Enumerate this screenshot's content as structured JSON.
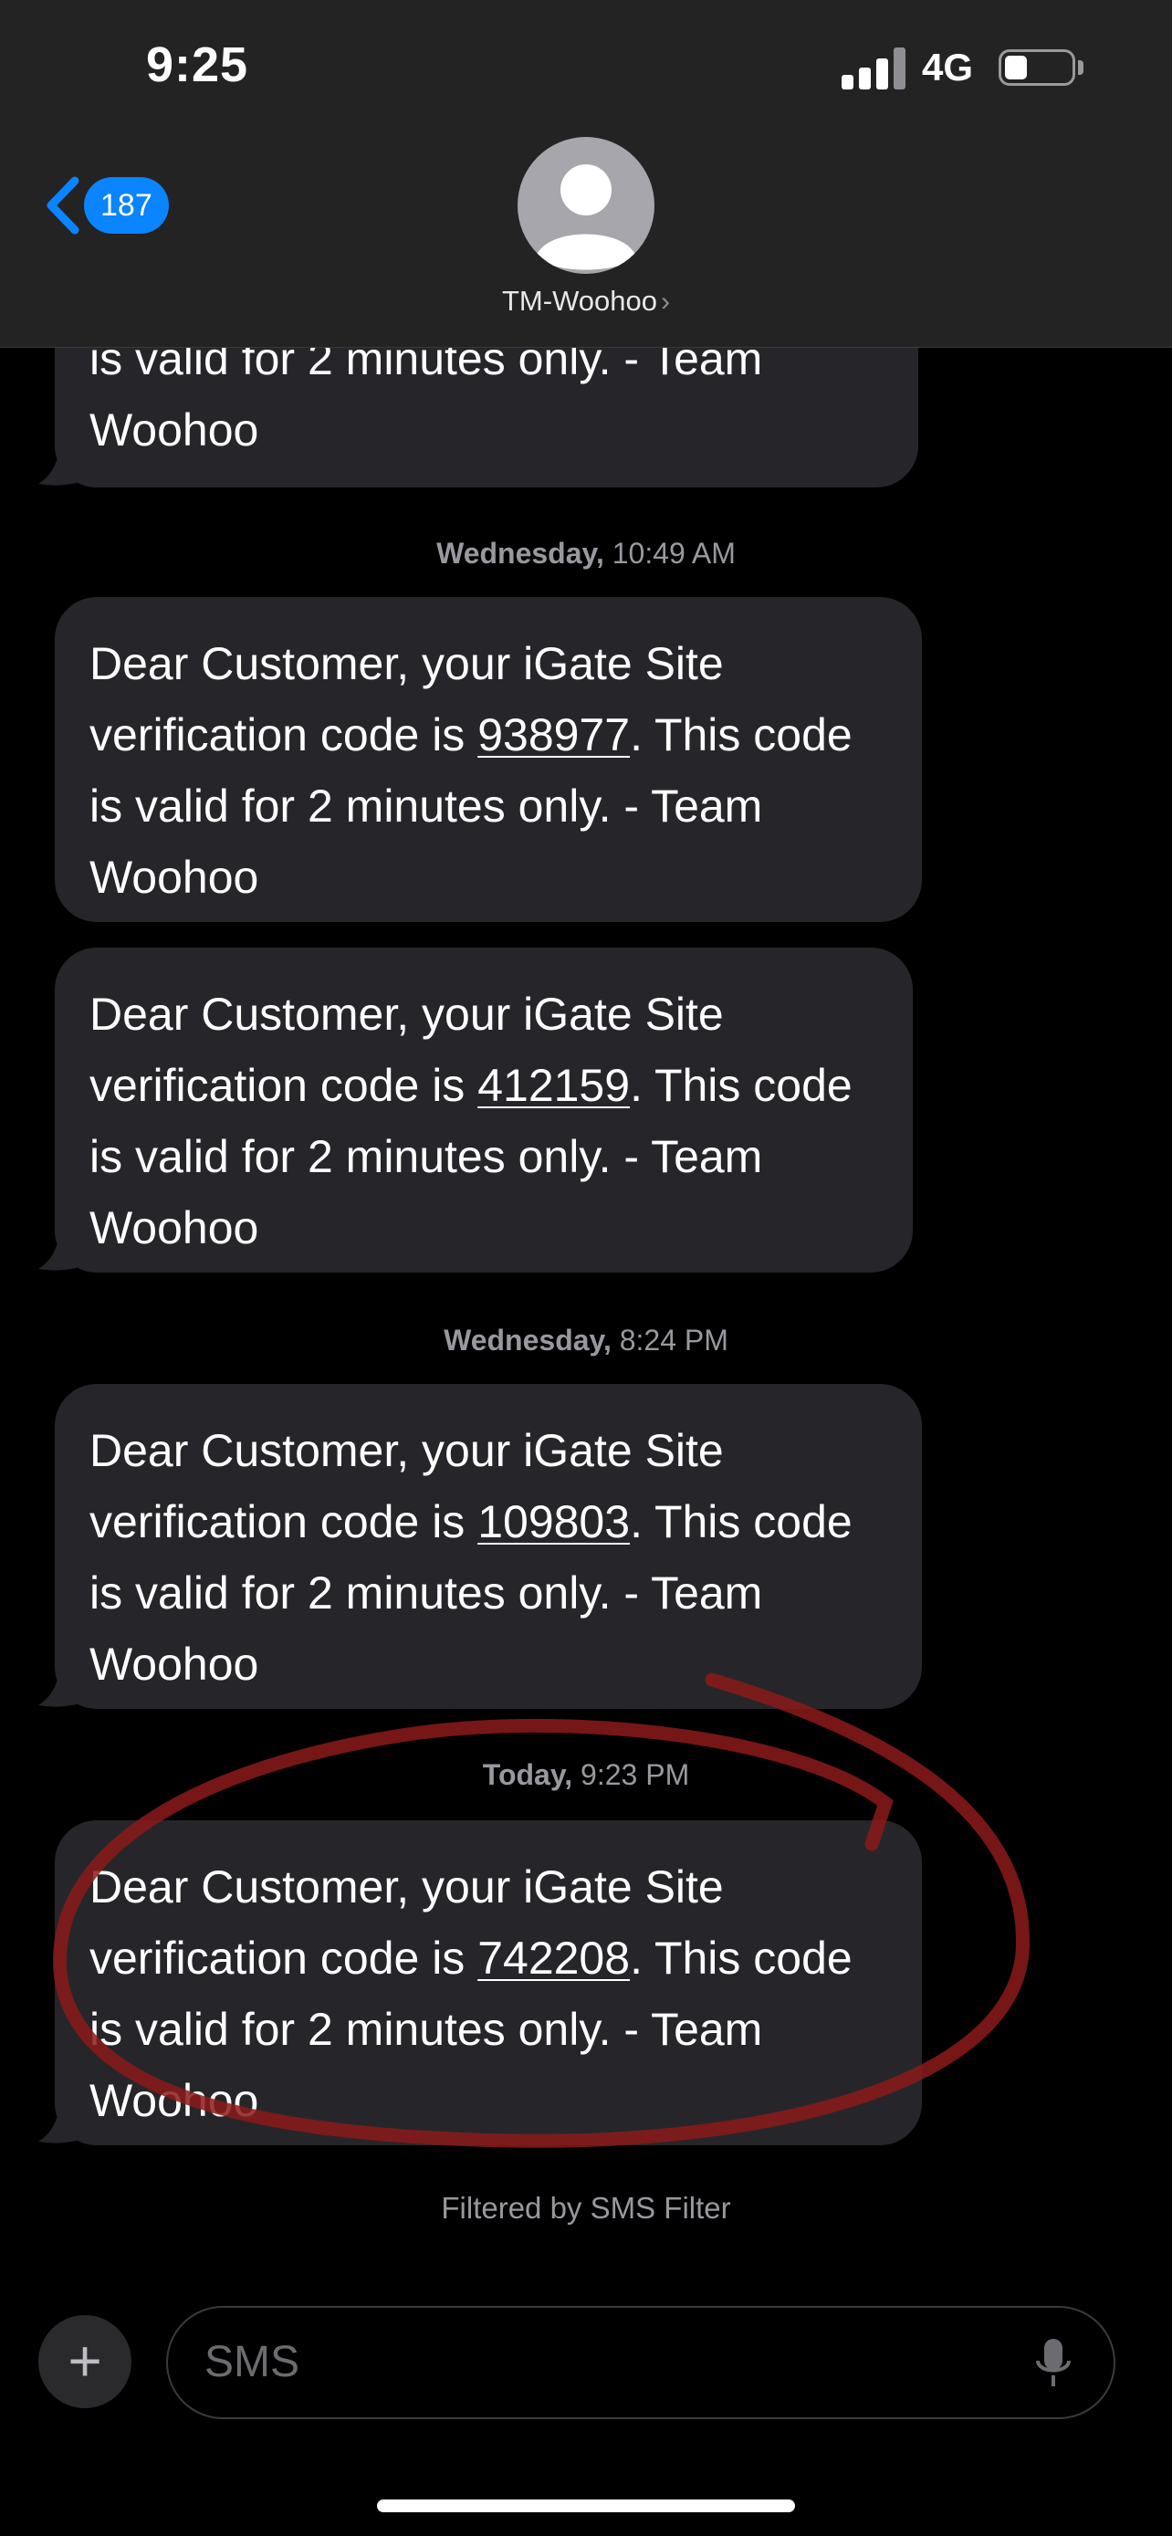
{
  "status_bar": {
    "time": "9:25",
    "network": "4G"
  },
  "header": {
    "back_count": "187",
    "contact_name": "TM-Woohoo",
    "contact_chevron": "›"
  },
  "thread": {
    "partial_message": {
      "line1": "is valid for 2 minutes only. - Team",
      "line2": "Woohoo"
    },
    "groups": [
      {
        "timestamp_day": "Wednesday,",
        "timestamp_time": "10:49 AM",
        "messages": [
          {
            "prefix": "Dear Customer, your iGate Site",
            "line2_start": "verification code is ",
            "code": "938977",
            "line2_end": ". This code",
            "line3": "is valid for 2 minutes only. - Team",
            "line4": "Woohoo"
          },
          {
            "prefix": "Dear Customer, your iGate Site",
            "line2_start": "verification code is ",
            "code": "412159",
            "line2_end": ". This code",
            "line3": "is valid for 2 minutes only. - Team",
            "line4": "Woohoo"
          }
        ]
      },
      {
        "timestamp_day": "Wednesday,",
        "timestamp_time": "8:24 PM",
        "messages": [
          {
            "prefix": "Dear Customer, your iGate Site",
            "line2_start": "verification code is ",
            "code": "109803",
            "line2_end": ". This code",
            "line3": "is valid for 2 minutes only. - Team",
            "line4": "Woohoo"
          }
        ]
      },
      {
        "timestamp_day": "Today,",
        "timestamp_time": "9:23 PM",
        "messages": [
          {
            "prefix": "Dear Customer, your iGate Site",
            "line2_start": "verification code is ",
            "code": "742208",
            "line2_end": ". This code",
            "line3": "is valid for 2 minutes only. - Team",
            "line4": "Woohoo"
          }
        ]
      }
    ],
    "filter_note": "Filtered by SMS Filter"
  },
  "composer": {
    "plus_label": "+",
    "placeholder": "SMS"
  },
  "icons": {
    "back": "chevron-left-icon",
    "avatar": "person-icon",
    "mic": "microphone-icon",
    "plus": "plus-icon"
  },
  "colors": {
    "accent": "#0a84ff",
    "bubble": "#26262a",
    "header": "#232323",
    "annotation": "#8b1a1a"
  }
}
